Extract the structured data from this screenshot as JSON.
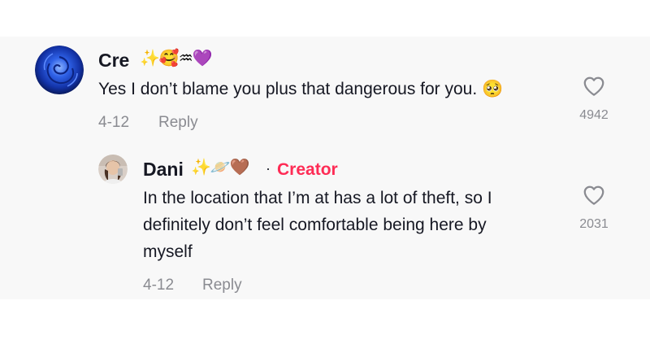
{
  "comment": {
    "username": "Cre",
    "name_emojis": "✨🥰♒💜",
    "text": "Yes I don’t blame you plus that dangerous for you. 🥺",
    "date": "4-12",
    "reply_label": "Reply",
    "like_count": "4942"
  },
  "reply": {
    "username": "Dani",
    "name_emojis": "✨🪐🤎",
    "separator": "·",
    "badge": "Creator",
    "text_lines": [
      "In the location that I’m at has a lot of theft, so I",
      "definitely don’t feel comfortable being here by",
      "myself"
    ],
    "date": "4-12",
    "reply_label": "Reply",
    "like_count": "2031"
  },
  "colors": {
    "accent": "#fe2c55",
    "muted_text": "#8a8b91",
    "panel_bg": "#f8f8f8"
  },
  "icons": {
    "like": "heart-outline-icon"
  }
}
